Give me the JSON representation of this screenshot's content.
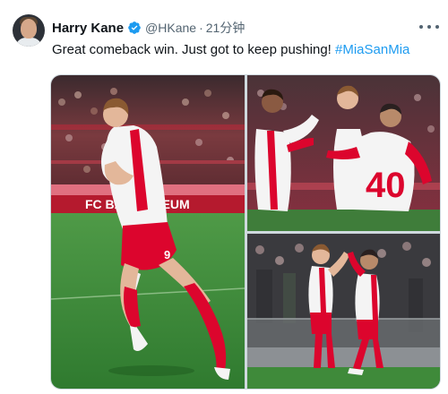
{
  "tweet": {
    "author_name": "Harry Kane",
    "handle": "@HKane",
    "separator": "·",
    "time": "21分钟",
    "text_prefix": "Great comeback win. Just got to keep pushing! ",
    "hashtag": "#MiaSanMia"
  },
  "media": {
    "photo1": {
      "board_text": "FC BAY    MUSEUM",
      "shirt_number": "9"
    },
    "photo2": {
      "shirt_number": "40"
    },
    "photo3": {}
  },
  "icons": {
    "verified": "verified-badge-icon",
    "more": "more-options-icon"
  },
  "colors": {
    "verified_blue": "#1d9bf0",
    "hashtag_blue": "#1d9bf0",
    "bayern_red": "#dc052d",
    "pitch_green": "#3f8a3a"
  }
}
